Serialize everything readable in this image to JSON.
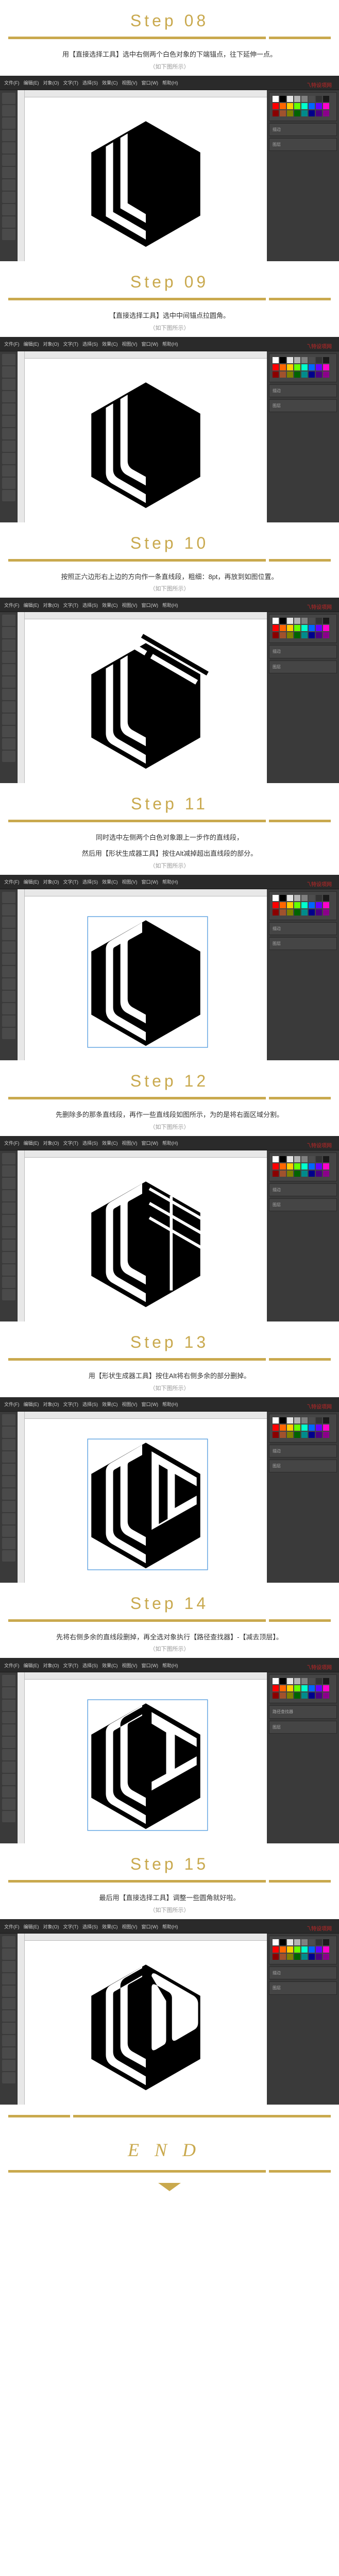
{
  "accent": "#c9a94e",
  "watermark": {
    "main": "乁特设项网",
    "sub": ""
  },
  "ai_menu": [
    "文件(F)",
    "编辑(E)",
    "对象(O)",
    "文字(T)",
    "选择(S)",
    "效果(C)",
    "视图(V)",
    "窗口(W)",
    "帮助(H)"
  ],
  "steps": [
    {
      "id": 8,
      "title": "Step 08",
      "instructions": [
        "用【直接选择工具】选中右侧两个白色对象的下端锚点，往下延伸一点。"
      ],
      "hint": "（如下图所示）",
      "screenshot_h": 360,
      "logo_variant": "v1"
    },
    {
      "id": 9,
      "title": "Step 09",
      "instructions": [
        "【直接选择工具】选中中间锚点拉圆角。"
      ],
      "hint": "（如下图所示）",
      "screenshot_h": 360,
      "logo_variant": "v2"
    },
    {
      "id": 10,
      "title": "Step 10",
      "instructions": [
        "按照正六边形右上边的方向作一条直线段，粗细：8pt，再放到如图位置。"
      ],
      "hint": "（如下图所示）",
      "screenshot_h": 360,
      "logo_variant": "v3"
    },
    {
      "id": 11,
      "title": "Step 11",
      "instructions": [
        "同时选中左侧两个白色对象跟上一步作的直线段，",
        "然后用【形状生成器工具】按住Alt减掉超出直线段的部分。"
      ],
      "hint": "（如下图所示）",
      "screenshot_h": 360,
      "logo_variant": "v4"
    },
    {
      "id": 12,
      "title": "Step 12",
      "instructions": [
        "先删除多的那条直线段，再作一些直线段如图所示，为的是将右面区域分割。"
      ],
      "hint": "（如下图所示）",
      "screenshot_h": 360,
      "logo_variant": "v5"
    },
    {
      "id": 13,
      "title": "Step 13",
      "instructions": [
        "用【形状生成器工具】按住Alt将右侧多余的部分删掉。"
      ],
      "hint": "（如下图所示）",
      "screenshot_h": 360,
      "logo_variant": "v6"
    },
    {
      "id": 14,
      "title": "Step 14",
      "instructions": [
        "先将右侧多余的直线段删掉，再全选对象执行【路径查找器】-【减去顶层】。"
      ],
      "hint": "（如下图所示）",
      "screenshot_h": 360,
      "logo_variant": "v7"
    },
    {
      "id": 15,
      "title": "Step 15",
      "instructions": [
        "最后用【直接选择工具】调整一些圆角就好啦。"
      ],
      "hint": "（如下图所示）",
      "screenshot_h": 360,
      "logo_variant": "v8"
    }
  ],
  "end": {
    "text": "END"
  },
  "swatch_colors": [
    [
      "#ffffff",
      "#000000",
      "#e6e6e6",
      "#b3b3b3",
      "#808080",
      "#4d4d4d",
      "#333333",
      "#1a1a1a"
    ],
    [
      "#ff0000",
      "#ff6600",
      "#ffcc00",
      "#66ff00",
      "#00ffcc",
      "#0066ff",
      "#6600ff",
      "#ff00cc"
    ],
    [
      "#8b0000",
      "#a0522d",
      "#808000",
      "#006400",
      "#008b8b",
      "#00008b",
      "#4b0082",
      "#8b008b"
    ]
  ]
}
